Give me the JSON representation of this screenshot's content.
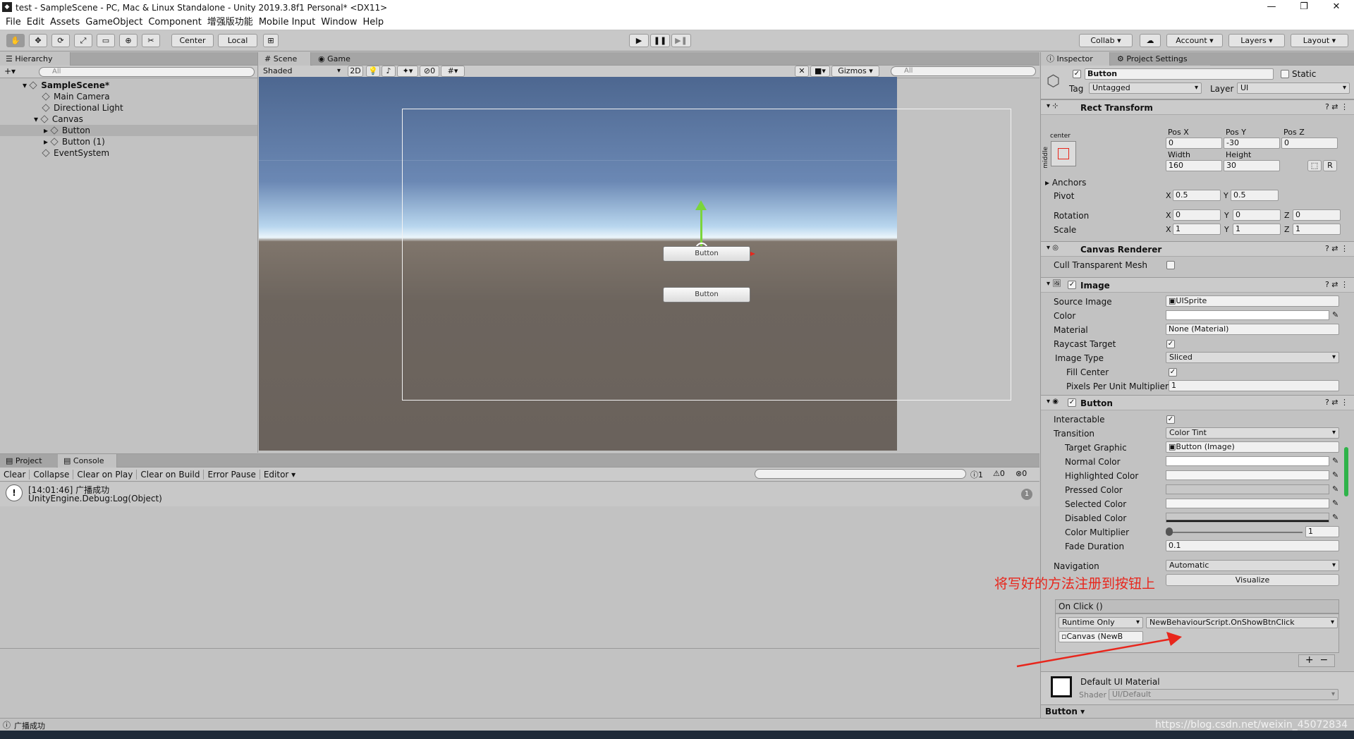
{
  "window": {
    "title": "test - SampleScene - PC, Mac & Linux Standalone - Unity 2019.3.8f1 Personal* <DX11>",
    "app_icon": "unity-icon",
    "minimize": "—",
    "maximize": "❐",
    "close": "✕"
  },
  "menu": [
    "File",
    "Edit",
    "Assets",
    "GameObject",
    "Component",
    "增强版功能",
    "Mobile Input",
    "Window",
    "Help"
  ],
  "toolbar": {
    "pivot": "Center",
    "space": "Local",
    "collab": "Collab",
    "account": "Account",
    "layers": "Layers",
    "layout": "Layout"
  },
  "hierarchy": {
    "tab": "Hierarchy",
    "add": "+▾",
    "search_placeholder": "All",
    "scene": "SampleScene*",
    "items": [
      "Main Camera",
      "Directional Light",
      "Canvas",
      "Button",
      "Button (1)",
      "EventSystem"
    ]
  },
  "scene": {
    "tab_scene": "Scene",
    "tab_game": "Game",
    "shading": "Shaded",
    "mode2d": "2D",
    "hidden_count": "0",
    "gizmos": "Gizmos",
    "search_placeholder": "All",
    "button1": "Button",
    "button2": "Button"
  },
  "bottom": {
    "tab_project": "Project",
    "tab_console": "Console",
    "buttons": [
      "Clear",
      "Collapse",
      "Clear on Play",
      "Clear on Build",
      "Error Pause",
      "Editor ▾"
    ],
    "counts": [
      "1",
      "0",
      "0"
    ],
    "log_time_msg": "[14:01:46] 广播成功",
    "log_detail": "UnityEngine.Debug:Log(Object)",
    "log_count": "1"
  },
  "inspector": {
    "tab": "Inspector",
    "tab2": "Project Settings",
    "object_name": "Button",
    "static_label": "Static",
    "tag_label": "Tag",
    "tag_value": "Untagged",
    "layer_label": "Layer",
    "layer_value": "UI",
    "rect": {
      "title": "Rect Transform",
      "anchor_h": "center",
      "anchor_v": "middle",
      "posx_l": "Pos X",
      "posy_l": "Pos Y",
      "posz_l": "Pos Z",
      "posx": "0",
      "posy": "-30",
      "posz": "0",
      "width_l": "Width",
      "height_l": "Height",
      "width": "160",
      "height": "30",
      "r": "R",
      "anchors": "Anchors",
      "pivot": "Pivot",
      "pivot_x": "0.5",
      "pivot_y": "0.5",
      "rotation": "Rotation",
      "rot_x": "0",
      "rot_y": "0",
      "rot_z": "0",
      "scale": "Scale",
      "sc_x": "1",
      "sc_y": "1",
      "sc_z": "1",
      "x": "X",
      "y": "Y",
      "z": "Z"
    },
    "canvas_renderer": {
      "title": "Canvas Renderer",
      "cull": "Cull Transparent Mesh"
    },
    "image": {
      "title": "Image",
      "source_l": "Source Image",
      "source": "UISprite",
      "color_l": "Color",
      "material_l": "Material",
      "material": "None (Material)",
      "raycast_l": "Raycast Target",
      "type_l": "Image Type",
      "type": "Sliced",
      "fill_l": "Fill Center",
      "ppu_l": "Pixels Per Unit Multiplier",
      "ppu": "1"
    },
    "button": {
      "title": "Button",
      "interactable_l": "Interactable",
      "transition_l": "Transition",
      "transition": "Color Tint",
      "target_l": "Target Graphic",
      "target": "Button (Image)",
      "normal_l": "Normal Color",
      "highlight_l": "Highlighted Color",
      "pressed_l": "Pressed Color",
      "selected_l": "Selected Color",
      "disabled_l": "Disabled Color",
      "multiplier_l": "Color Multiplier",
      "multiplier": "1",
      "multiplier_level": 1.0,
      "fade_l": "Fade Duration",
      "fade": "0.1",
      "nav_l": "Navigation",
      "nav": "Automatic",
      "visualize": "Visualize",
      "onclick": "On Click ()",
      "runtime": "Runtime Only",
      "method": "NewBehaviourScript.OnShowBtnClick",
      "object": "Canvas (NewB",
      "plus": "+",
      "minus": "−"
    },
    "material": {
      "name": "Default UI Material",
      "shader_l": "Shader",
      "shader": "UI/Default"
    },
    "footer": "Button ▾"
  },
  "annotation": "将写好的方法注册到按钮上",
  "status": "广播成功",
  "watermark": "https://blog.csdn.net/weixin_45072834",
  "colors": {
    "annotation": "#e8261c",
    "gizmo_y": "#7bd53b",
    "gizmo_x": "#e8261c"
  }
}
